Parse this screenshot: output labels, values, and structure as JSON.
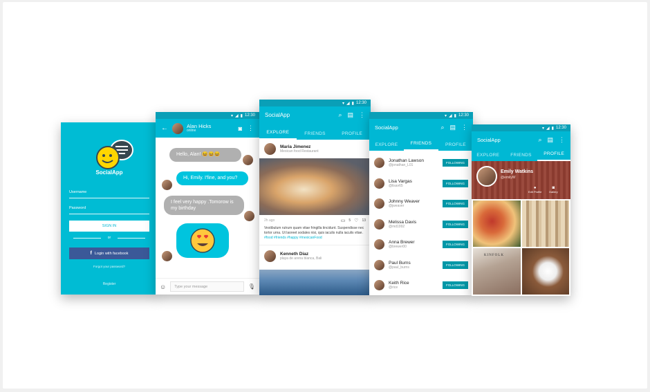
{
  "login": {
    "app_name": "SocialApp",
    "username_label": "Username",
    "password_label": "Password",
    "signin_label": "SIGN IN",
    "or_label": "or",
    "facebook_label": "Login with facebook",
    "forgot_label": "Forgot your password?",
    "register_label": "Register"
  },
  "chat": {
    "time": "12:30",
    "contact_name": "Alan Hicks",
    "contact_status": "online",
    "messages": [
      {
        "text": "Hello, Alan! 😆😆😆"
      },
      {
        "text": "Hi, Emily.  I'fine, and you?"
      },
      {
        "text": "I feel very happy .Tomorow is my birthday"
      }
    ],
    "input_placeholder": "Type your message"
  },
  "explore": {
    "time": "12:30",
    "title": "SocialApp",
    "tabs": [
      "EXPLORE",
      "FRIENDS",
      "PROFILE"
    ],
    "post1": {
      "name": "Maria Jimenez",
      "place": "Mexican food Restaurant",
      "time": "2h ago",
      "comments": "5",
      "likes": "13",
      "text": "Vestibulum rutrum quam vitae fringilla tincidunt. Suspendisse nec tortor urna. Ut laoreet sodales nisi, quis iaculis nulla iaculis vitae.",
      "tags": "#food #friends #happy #mexicanFood"
    },
    "post2": {
      "name": "Kenneth Diaz",
      "place": "playa de arena blanca, Bali"
    }
  },
  "friends": {
    "time": "12:30",
    "title": "SocialApp",
    "tabs": [
      "EXPLORE",
      "FRIENDS",
      "PROFILE"
    ],
    "follow_label": "FOLLOWING",
    "list": [
      {
        "name": "Jonathan Lawson",
        "handle": "@jonathan_L01"
      },
      {
        "name": "Lisa Vargas",
        "handle": "@lisav65"
      },
      {
        "name": "Johnny Weaver",
        "handle": "@jweaver"
      },
      {
        "name": "Melissa Davis",
        "handle": "@md1992"
      },
      {
        "name": "Anna Brewer",
        "handle": "@brewer00"
      },
      {
        "name": "Paul Burns",
        "handle": "@paul_burns"
      },
      {
        "name": "Keith Rice",
        "handle": "@rice"
      }
    ]
  },
  "profile": {
    "time": "12:30",
    "title": "SocialApp",
    "tabs": [
      "EXPLORE",
      "FRIENDS",
      "PROFILE"
    ],
    "name": "Emily Watkins",
    "handle": "@emilyW",
    "stat1": "Edit Profile",
    "stat2": "Gallery",
    "photo_label": "KINFOLK"
  },
  "colors": {
    "accent": "#00b8d4",
    "facebook": "#3b5998",
    "follow": "#0097a7"
  }
}
